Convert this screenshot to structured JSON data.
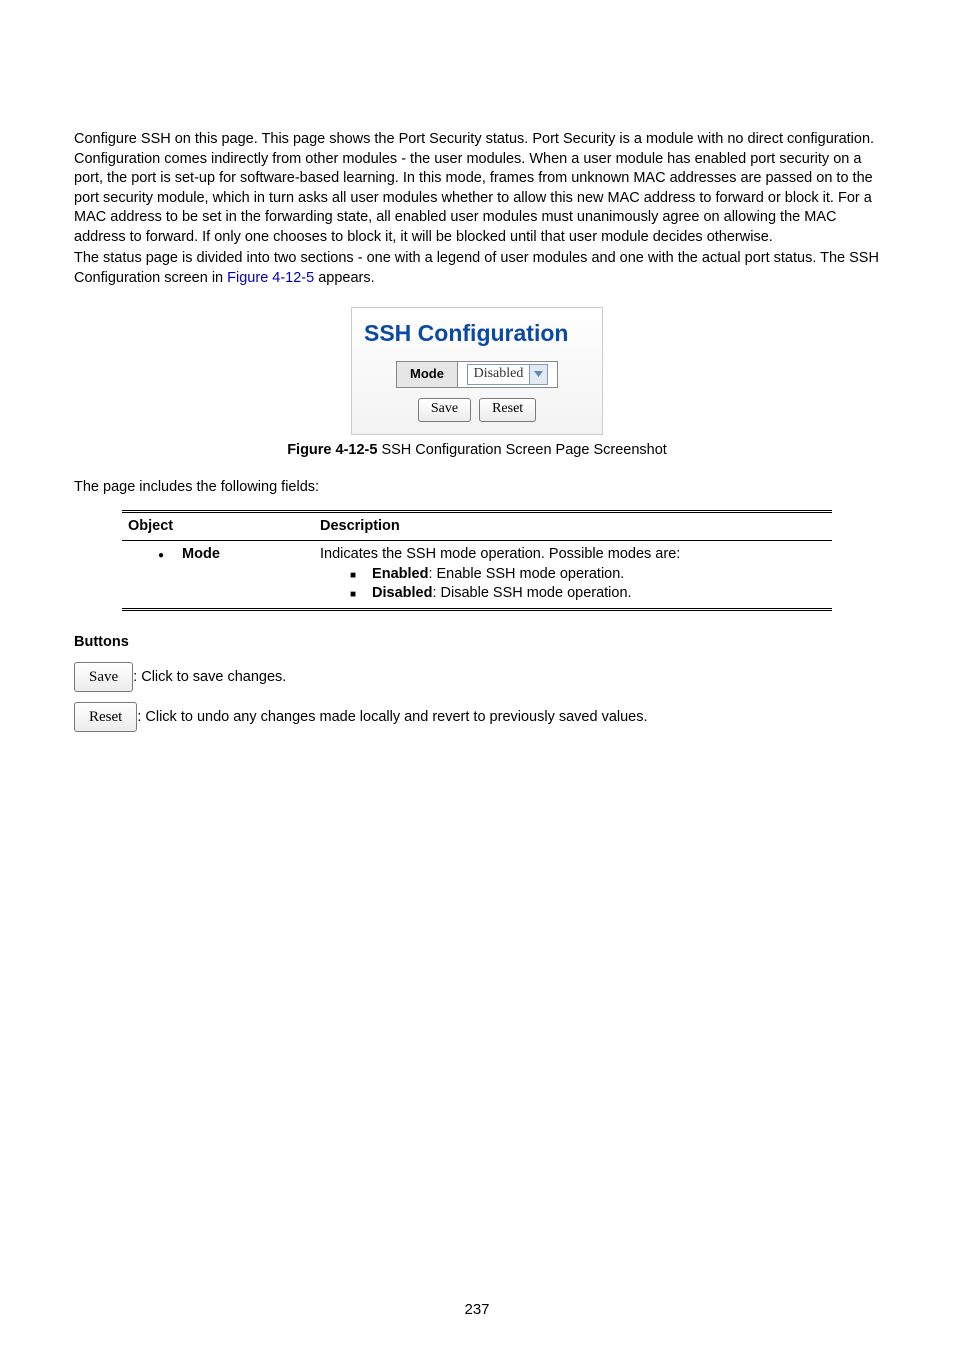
{
  "intro_para": "Configure SSH on this page. This page shows the Port Security status. Port Security is a module with no direct configuration. Configuration comes indirectly from other modules - the user modules. When a user module has enabled port security on a port, the port is set-up for software-based learning. In this mode, frames from unknown MAC addresses are passed on to the port security module, which in turn asks all user modules whether to allow this new MAC address to forward or block it. For a MAC address to be set in the forwarding state, all enabled user modules must unanimously agree on allowing the MAC address to forward. If only one chooses to block it, it will be blocked until that user module decides otherwise.",
  "status_line_pre": "The status page is divided into two sections - one with a legend of user modules and one with the actual port status. The SSH Configuration screen in ",
  "status_line_link": "Figure 4-12-5",
  "status_line_post": " appears.",
  "ssh_card": {
    "title": "SSH Configuration",
    "mode_label": "Mode",
    "mode_value": "Disabled",
    "save": "Save",
    "reset": "Reset"
  },
  "figure_caption_pre": "Figure 4-12-5",
  "figure_caption_post": " SSH Configuration Screen Page Screenshot",
  "fields_intro": "The page includes the following fields:",
  "table": {
    "header_object": "Object",
    "header_desc": "Description",
    "row": {
      "label": "Mode",
      "desc_main": "Indicates the SSH mode operation. Possible modes are:",
      "enabled_key": "Enabled",
      "enabled_text": ": Enable SSH mode operation.",
      "disabled_key": "Disabled",
      "disabled_text": ": Disable SSH mode operation."
    }
  },
  "buttons_heading": "Buttons",
  "save_btn": "Save",
  "save_text": ": Click to save changes.",
  "reset_btn": "Reset",
  "reset_text": ": Click to undo any changes made locally and revert to previously saved values.",
  "page_number": "237"
}
